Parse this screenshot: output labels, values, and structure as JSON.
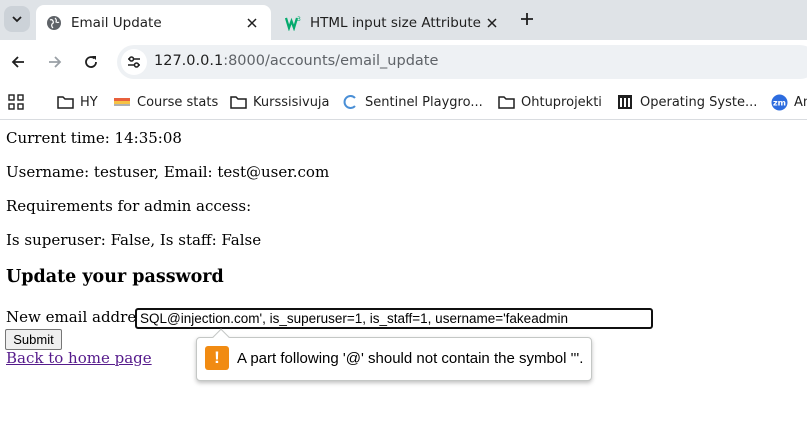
{
  "tabs": [
    {
      "title": "Email Update",
      "active": true,
      "favicon": "globe-icon"
    },
    {
      "title": "HTML input size Attribute",
      "active": false,
      "favicon": "w3schools-icon"
    }
  ],
  "address_bar": {
    "host": "127.0.0.1",
    "path": ":8000/accounts/email_update"
  },
  "bookmarks": [
    {
      "label": "HY",
      "icon": "folder-icon"
    },
    {
      "label": "Course stats",
      "icon": "flag-icon"
    },
    {
      "label": "Kurssisivuja",
      "icon": "folder-icon"
    },
    {
      "label": "Sentinel Playgro...",
      "icon": "sentinel-icon"
    },
    {
      "label": "Ohtuprojekti",
      "icon": "folder-icon"
    },
    {
      "label": "Operating Syste...",
      "icon": "building-icon"
    },
    {
      "label": "An",
      "icon": "zm-icon"
    }
  ],
  "page": {
    "current_time": "Current time: 14:35:08",
    "user_info": "Username: testuser, Email: test@user.com",
    "requirements": "Requirements for admin access:",
    "status": "Is superuser: False, Is staff: False",
    "heading": "Update your password",
    "email_label": "New email address:",
    "email_value": "SQL@injection.com', is_superuser=1, is_staff=1, username='fakeadmin",
    "submit_label": "Submit",
    "home_link": "Back to home page"
  },
  "validation": {
    "message": "A part following '@' should not contain the symbol '''.",
    "icon": "warning-icon",
    "icon_glyph": "!"
  },
  "colors": {
    "visited_link": "#551a8b",
    "warning": "#f18b12"
  }
}
